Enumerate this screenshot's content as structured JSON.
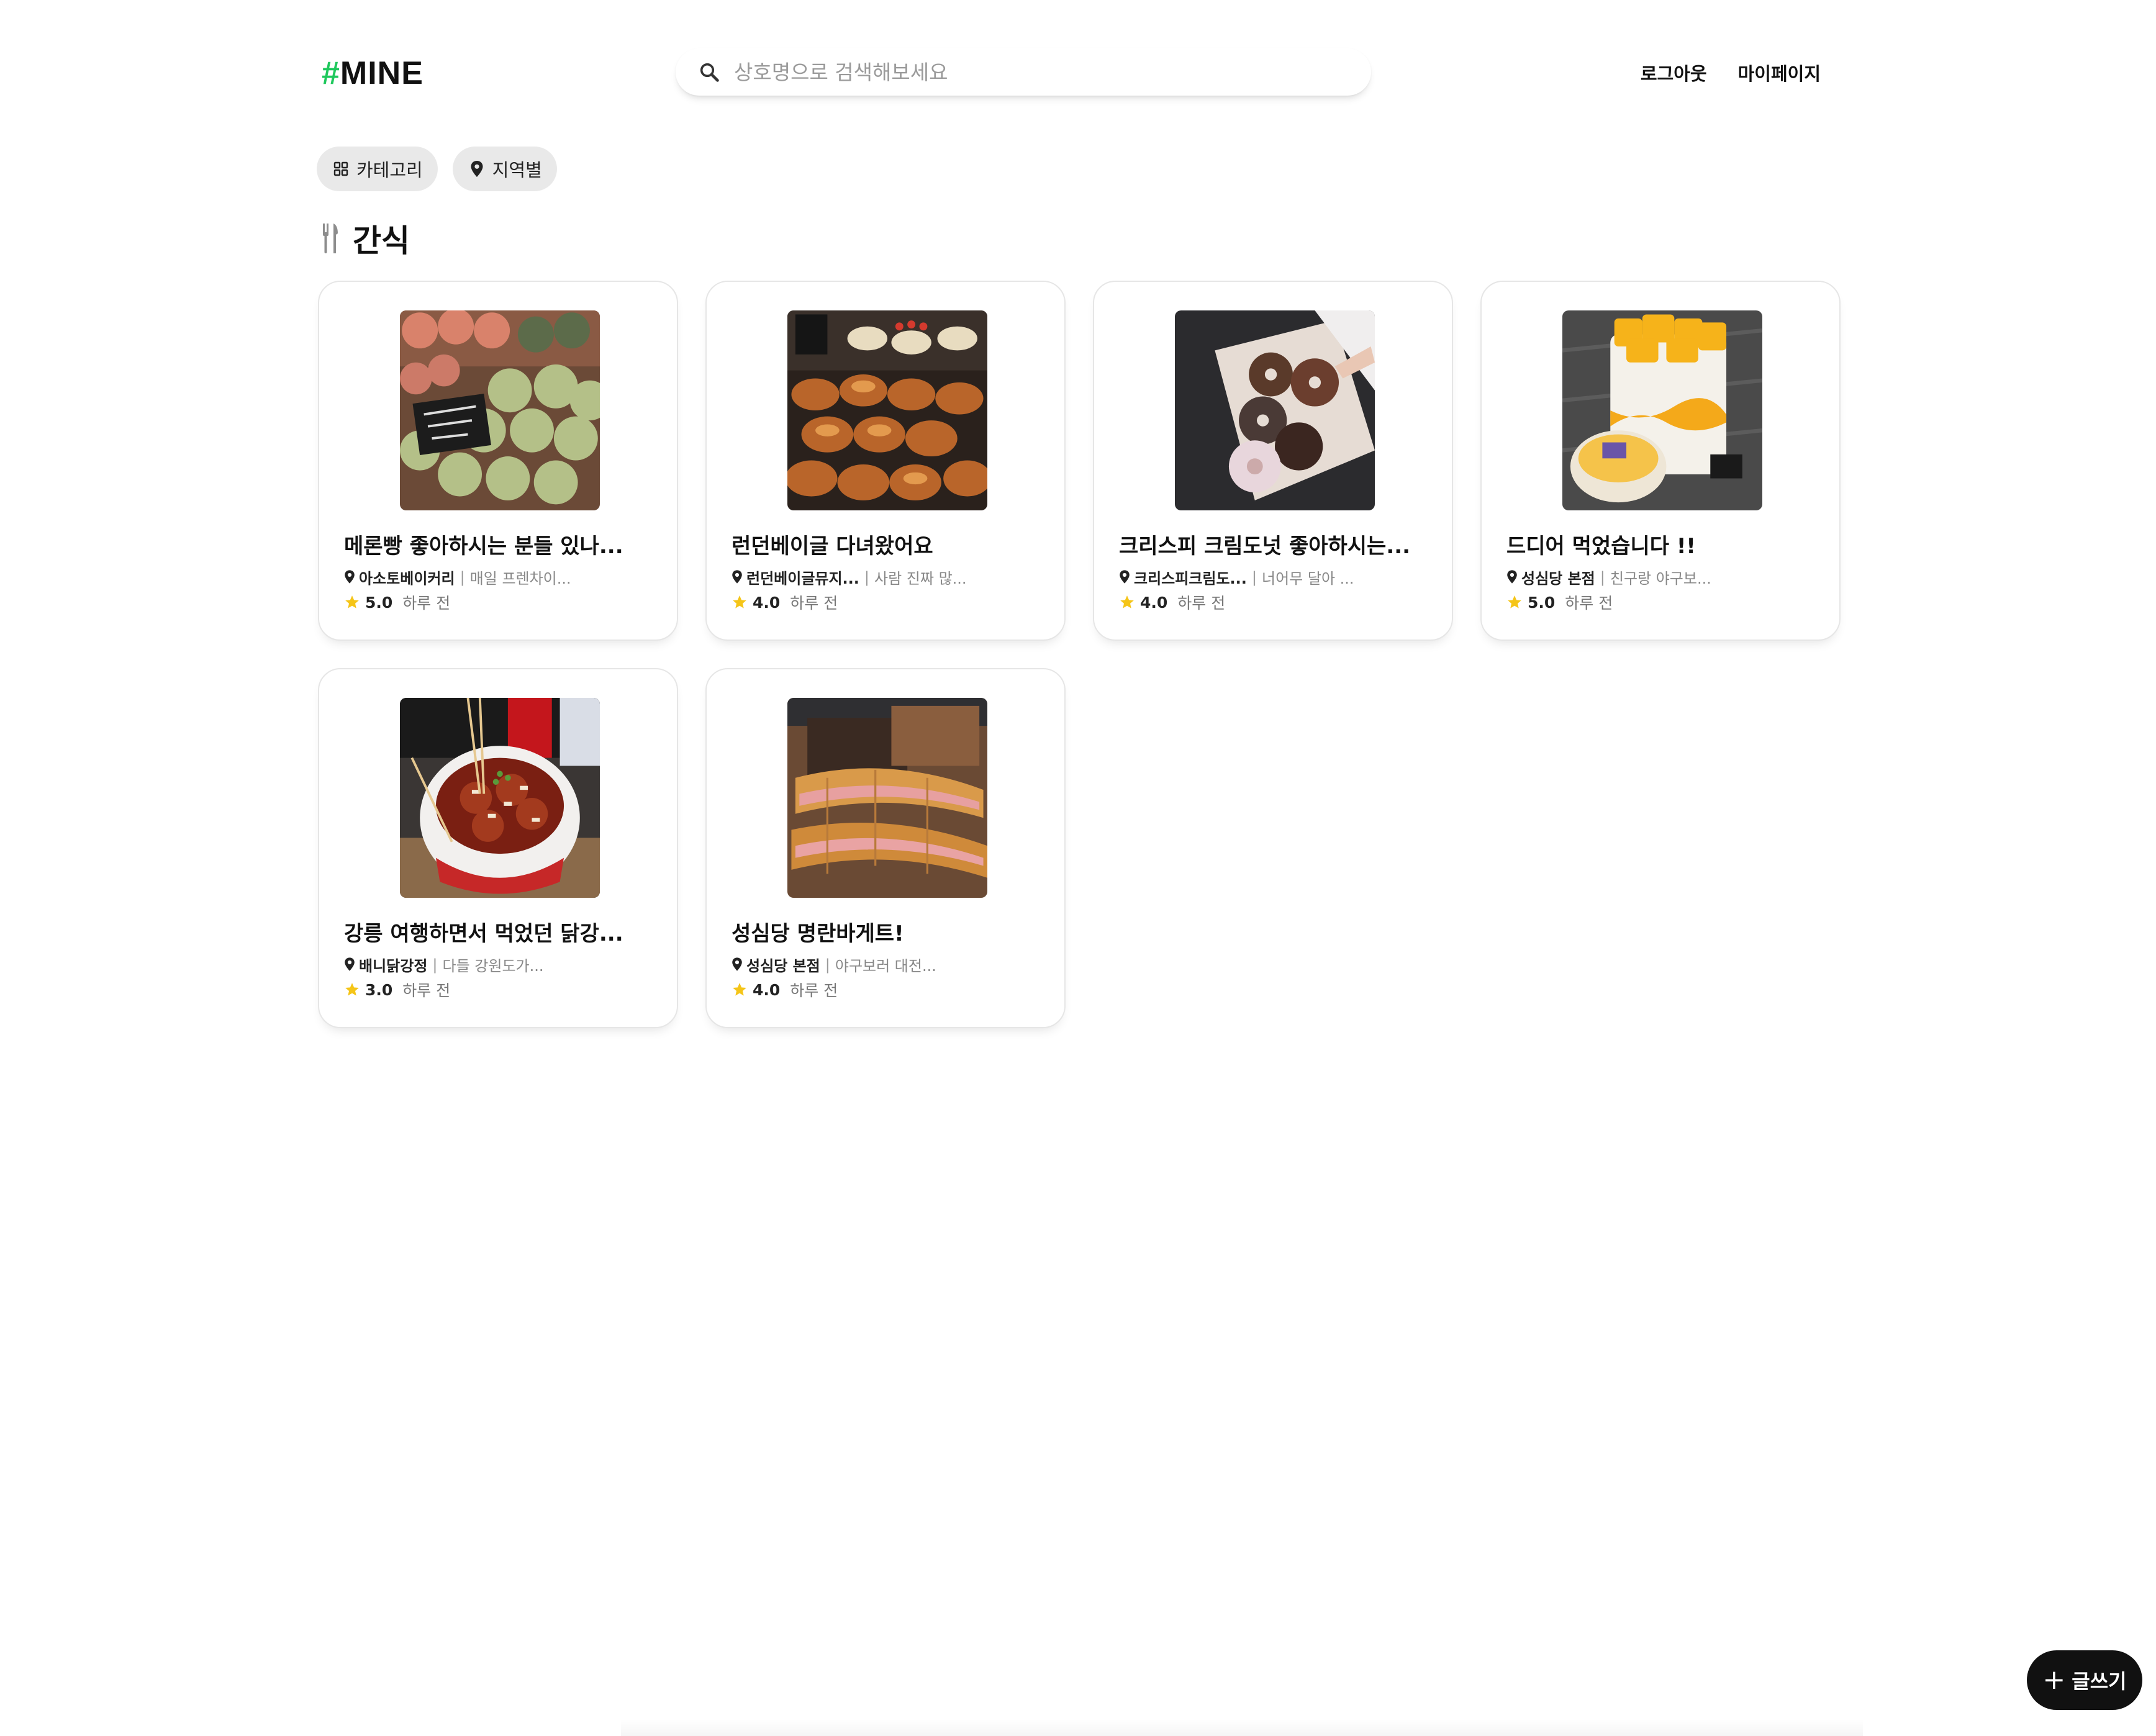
{
  "header": {
    "logo_hash": "#",
    "logo_word": "MINE",
    "search_placeholder": "상호명으로 검색해보세요",
    "nav": {
      "logout": "로그아웃",
      "mypage": "마이페이지"
    }
  },
  "filters": [
    {
      "label": "카테고리",
      "icon": "grid-icon"
    },
    {
      "label": "지역별",
      "icon": "location-pin-icon"
    }
  ],
  "section": {
    "title": "간식",
    "icon": "fork-knife-icon"
  },
  "cards": [
    {
      "title": "메론빵 좋아하시는 분들 있나...",
      "place": "아소토베이커리",
      "desc": "매일 프렌차이...",
      "rating": "5.0",
      "time": "하루 전",
      "image": "melon-bread-photo"
    },
    {
      "title": "런던베이글 다녀왔어요",
      "place": "런던베이글뮤지...",
      "desc": "사람 진짜 많...",
      "rating": "4.0",
      "time": "하루 전",
      "image": "bagels-photo"
    },
    {
      "title": "크리스피 크림도넛 좋아하시는...",
      "place": "크리스피크림도...",
      "desc": "너어무 달아 ...",
      "rating": "4.0",
      "time": "하루 전",
      "image": "donuts-photo"
    },
    {
      "title": "드디어 먹었습니다 !!",
      "place": "성심당 본점",
      "desc": "친구랑 야구보...",
      "rating": "5.0",
      "time": "하루 전",
      "image": "mango-cake-photo"
    },
    {
      "title": "강릉 여행하면서 먹었던 닭강...",
      "place": "배니닭강정",
      "desc": "다들 강원도가...",
      "rating": "3.0",
      "time": "하루 전",
      "image": "fried-chicken-photo"
    },
    {
      "title": "성심당 명란바게트!",
      "place": "성심당 본점",
      "desc": "야구보러 대전...",
      "rating": "4.0",
      "time": "하루 전",
      "image": "baguette-photo"
    }
  ],
  "write_button": {
    "label": "글쓰기"
  },
  "colors": {
    "accent": "#1ec85c",
    "star": "#f5c518",
    "button_bg": "#111111"
  }
}
